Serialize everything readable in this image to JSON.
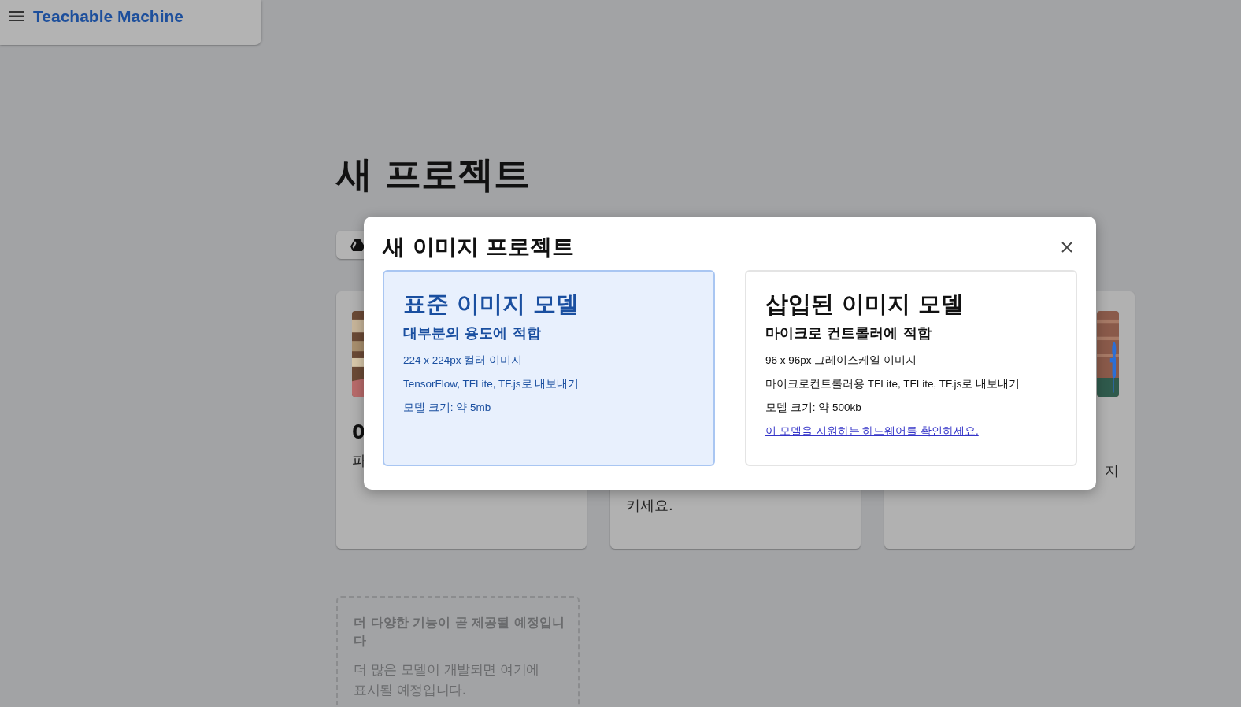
{
  "header": {
    "title": "Teachable Machine"
  },
  "page": {
    "title": "새 프로젝트",
    "cards": [
      {
        "media": {
          "kind": "picture"
        },
        "title": "0",
        "lines": [
          "파"
        ]
      },
      {
        "lines": [
          "키세요."
        ]
      },
      {
        "media": {
          "kind": "picture"
        },
        "lines": [
          "지"
        ]
      }
    ],
    "coming_soon": {
      "title": "더 다양한 기능이 곧 제공될 예정입니다",
      "text": "더 많은 모델이 개발되면 여기에 표시될 예정입니다."
    }
  },
  "dialog": {
    "title": "새 이미지 프로젝트",
    "options": [
      {
        "selected": true,
        "title": "표준 이미지 모델",
        "subtitle": "대부분의 용도에 적합",
        "details": [
          "224 x 224px 컬러 이미지",
          "TensorFlow, TFLite, TF.js로 내보내기",
          "모델 크기: 약 5mb"
        ]
      },
      {
        "selected": false,
        "title": "삽입된 이미지 모델",
        "subtitle": "마이크로 컨트롤러에 적합",
        "details": [
          "96 x 96px 그레이스케일 이미지",
          "마이크로컨트롤러용 TFLite, TFLite, TF.js로 내보내기",
          "모델 크기: 약 500kb"
        ],
        "link": "이 모델을 지원하는 하드웨어를 확인하세요."
      }
    ]
  }
}
